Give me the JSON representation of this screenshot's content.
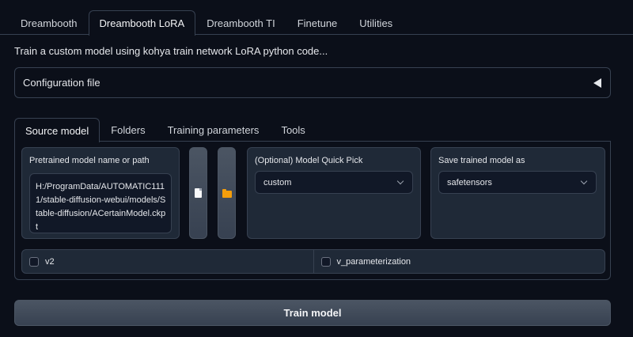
{
  "top_tabs": [
    "Dreambooth",
    "Dreambooth LoRA",
    "Dreambooth TI",
    "Finetune",
    "Utilities"
  ],
  "active_top_tab": "Dreambooth LoRA",
  "description": "Train a custom model using kohya train network LoRA python code...",
  "config": {
    "label": "Configuration file",
    "state": "collapsed"
  },
  "inner_tabs": [
    "Source model",
    "Folders",
    "Training parameters",
    "Tools"
  ],
  "active_inner_tab": "Source model",
  "source_model": {
    "pretrained_label": "Pretrained model name or path",
    "pretrained_value": "H:/ProgramData/AUTOMATIC1111/stable-diffusion-webui/models/Stable-diffusion/ACertainModel.ckpt",
    "file_icon": "document-icon",
    "folder_icon": "folder-icon",
    "quick_pick_label": "(Optional) Model Quick Pick",
    "quick_pick_value": "custom",
    "save_as_label": "Save trained model as",
    "save_as_value": "safetensors",
    "v2_label": "v2",
    "v2_checked": false,
    "v_param_label": "v_parameterization",
    "v_param_checked": false
  },
  "train_button": "Train model",
  "colors": {
    "background": "#0b0f19",
    "block": "#1f2937",
    "border": "#374151",
    "folder": "#f59e0b"
  }
}
